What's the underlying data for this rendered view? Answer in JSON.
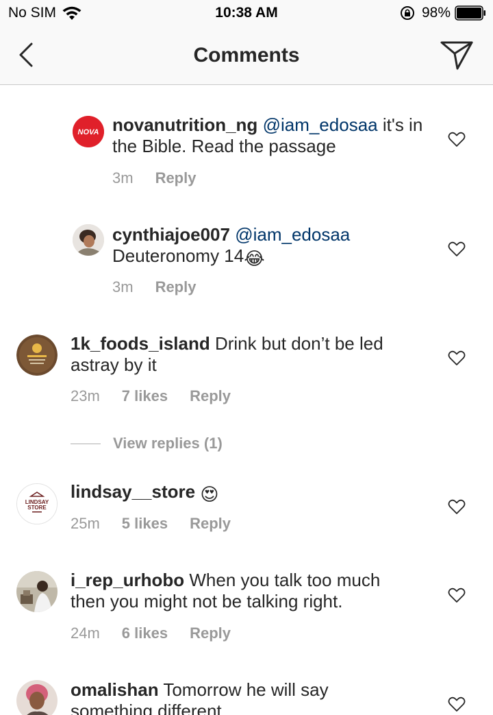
{
  "status_bar": {
    "carrier": "No SIM",
    "time": "10:38 AM",
    "battery": "98%"
  },
  "nav": {
    "title": "Comments"
  },
  "comments": [
    {
      "username": "novanutrition_ng",
      "mention": "@iam_edosaa",
      "text": " it's in the Bible. Read the passage",
      "time": "3m",
      "likes": "",
      "reply": "Reply",
      "avatar_label": "NOVA",
      "reply_level": true
    },
    {
      "username": "cynthiajoe007",
      "mention": "@iam_edosaa",
      "text": " Deuteronomy 14",
      "emoji": "😂",
      "time": "3m",
      "likes": "",
      "reply": "Reply",
      "reply_level": true
    },
    {
      "username": "1k_foods_island",
      "mention": "",
      "text": " Drink but don’t be led astray by it",
      "time": "23m",
      "likes": "7 likes",
      "reply": "Reply",
      "view_replies": "View replies (1)"
    },
    {
      "username": "lindsay__store",
      "mention": "",
      "text": " ",
      "emoji": "😍",
      "time": "25m",
      "likes": "5 likes",
      "reply": "Reply",
      "avatar_label_1": "LINDSAY",
      "avatar_label_2": "STORE"
    },
    {
      "username": "i_rep_urhobo",
      "mention": "",
      "text": " When you talk too much then you might not be talking right.",
      "time": "24m",
      "likes": "6 likes",
      "reply": "Reply"
    },
    {
      "username": "omalishan",
      "mention": "",
      "text": " Tomorrow he will say something different...",
      "time": "",
      "likes": "",
      "reply": ""
    }
  ],
  "colors": {
    "mention": "#003569",
    "meta": "#999999",
    "nova_red": "#e0202a"
  }
}
